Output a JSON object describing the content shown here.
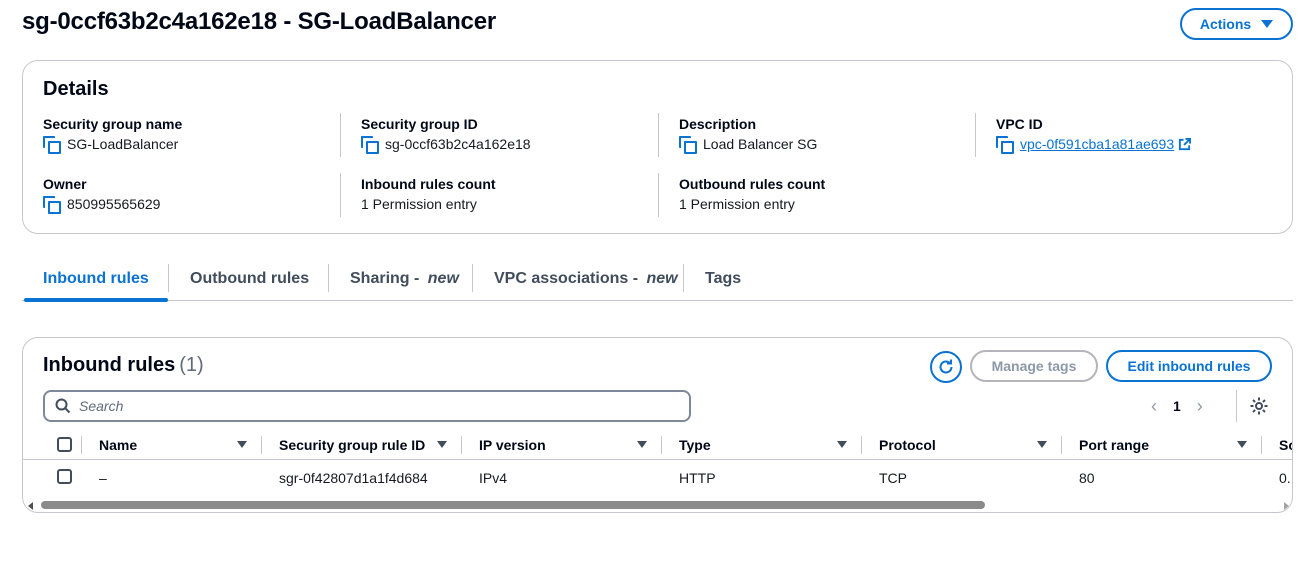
{
  "header": {
    "title": "sg-0ccf63b2c4a162e18 - SG-LoadBalancer",
    "actions_label": "Actions"
  },
  "details": {
    "heading": "Details",
    "fields": {
      "sg_name": {
        "label": "Security group name",
        "value": "SG-LoadBalancer"
      },
      "sg_id": {
        "label": "Security group ID",
        "value": "sg-0ccf63b2c4a162e18"
      },
      "description": {
        "label": "Description",
        "value": "Load Balancer SG"
      },
      "vpc_id": {
        "label": "VPC ID",
        "value": "vpc-0f591cba1a81ae693"
      },
      "owner": {
        "label": "Owner",
        "value": "850995565629"
      },
      "inbound_count": {
        "label": "Inbound rules count",
        "value": "1 Permission entry"
      },
      "outbound_count": {
        "label": "Outbound rules count",
        "value": "1 Permission entry"
      }
    }
  },
  "tabs": [
    {
      "label": "Inbound rules",
      "suffix": "",
      "active": true
    },
    {
      "label": "Outbound rules",
      "suffix": "",
      "active": false
    },
    {
      "label": "Sharing - ",
      "suffix": "new",
      "active": false
    },
    {
      "label": "VPC associations - ",
      "suffix": "new",
      "active": false
    },
    {
      "label": "Tags",
      "suffix": "",
      "active": false
    }
  ],
  "inbound": {
    "title": "Inbound rules",
    "count": "(1)",
    "manage_tags_label": "Manage tags",
    "edit_label": "Edit inbound rules",
    "search_placeholder": "Search",
    "page": "1",
    "columns": [
      "Name",
      "Security group rule ID",
      "IP version",
      "Type",
      "Protocol",
      "Port range",
      "So"
    ],
    "rows": [
      {
        "name": "–",
        "rule_id": "sgr-0f42807d1a1f4d684",
        "ip_version": "IPv4",
        "type": "HTTP",
        "protocol": "TCP",
        "port_range": "80",
        "source": "0."
      }
    ]
  },
  "icons": {
    "copy": "copy-icon",
    "external": "external-link-icon",
    "refresh": "refresh-icon",
    "search": "search-icon",
    "settings": "gear-icon"
  },
  "colors": {
    "accent": "#0972d3",
    "disabled": "#8d99a8",
    "border": "#c6c6cd"
  }
}
